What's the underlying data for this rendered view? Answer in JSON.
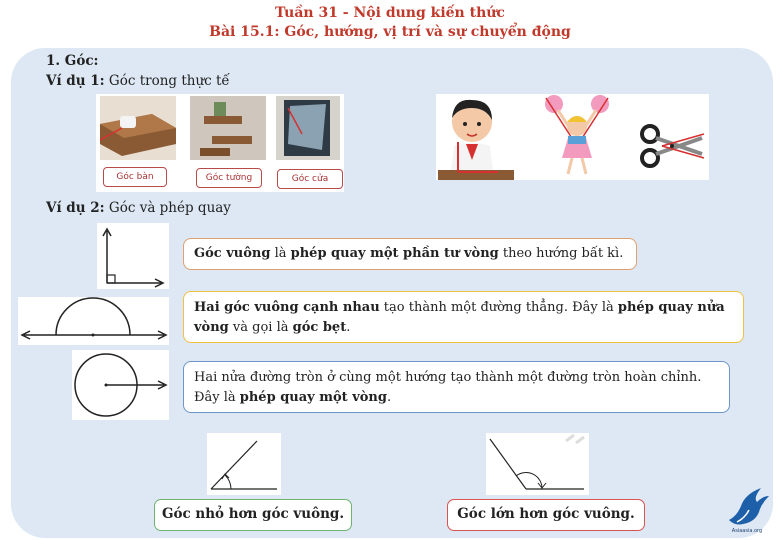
{
  "header": {
    "title_line1": "Tuần 31 - Nội dung kiến thức",
    "title_line2": "Bài 15.1: Góc, hướng, vị trí và sự chuyển động"
  },
  "section": {
    "heading": "1. Góc:",
    "example1_label": "Ví dụ 1:",
    "example1_text": " Góc trong thực tế",
    "example2_label": "Ví dụ 2:",
    "example2_text": " Góc và phép quay"
  },
  "photos": {
    "labels": [
      "Góc bàn",
      "Góc tường",
      "Góc cửa"
    ]
  },
  "boxes": {
    "b1": [
      {
        "text": "Góc vuông",
        "bold": true
      },
      {
        "text": " là ",
        "bold": false
      },
      {
        "text": "phép quay một phần tư vòng",
        "bold": true
      },
      {
        "text": " theo hướng bất kì.",
        "bold": false
      }
    ],
    "b2": [
      {
        "text": "Hai góc vuông cạnh nhau",
        "bold": true
      },
      {
        "text": " tạo thành một đường thẳng. Đây là ",
        "bold": false
      },
      {
        "text": "phép quay nửa vòng",
        "bold": true
      },
      {
        "text": " và gọi là ",
        "bold": false
      },
      {
        "text": "góc bẹt",
        "bold": true
      },
      {
        "text": ".",
        "bold": false
      }
    ],
    "b3": [
      {
        "text": "Hai nửa đường tròn ở cùng một hướng tạo thành một đường tròn hoàn chỉnh. Đây là ",
        "bold": false
      },
      {
        "text": "phép quay một vòng",
        "bold": true
      },
      {
        "text": ".",
        "bold": false
      }
    ]
  },
  "answers": {
    "small": "Góc nhỏ hơn góc vuông.",
    "large": "Góc lớn hơn góc vuông."
  },
  "logo": {
    "text": "Asiaasia.org"
  },
  "colors": {
    "title": "#c0392b",
    "panel": "#dde8f4",
    "highlight_red": "#d63030"
  }
}
